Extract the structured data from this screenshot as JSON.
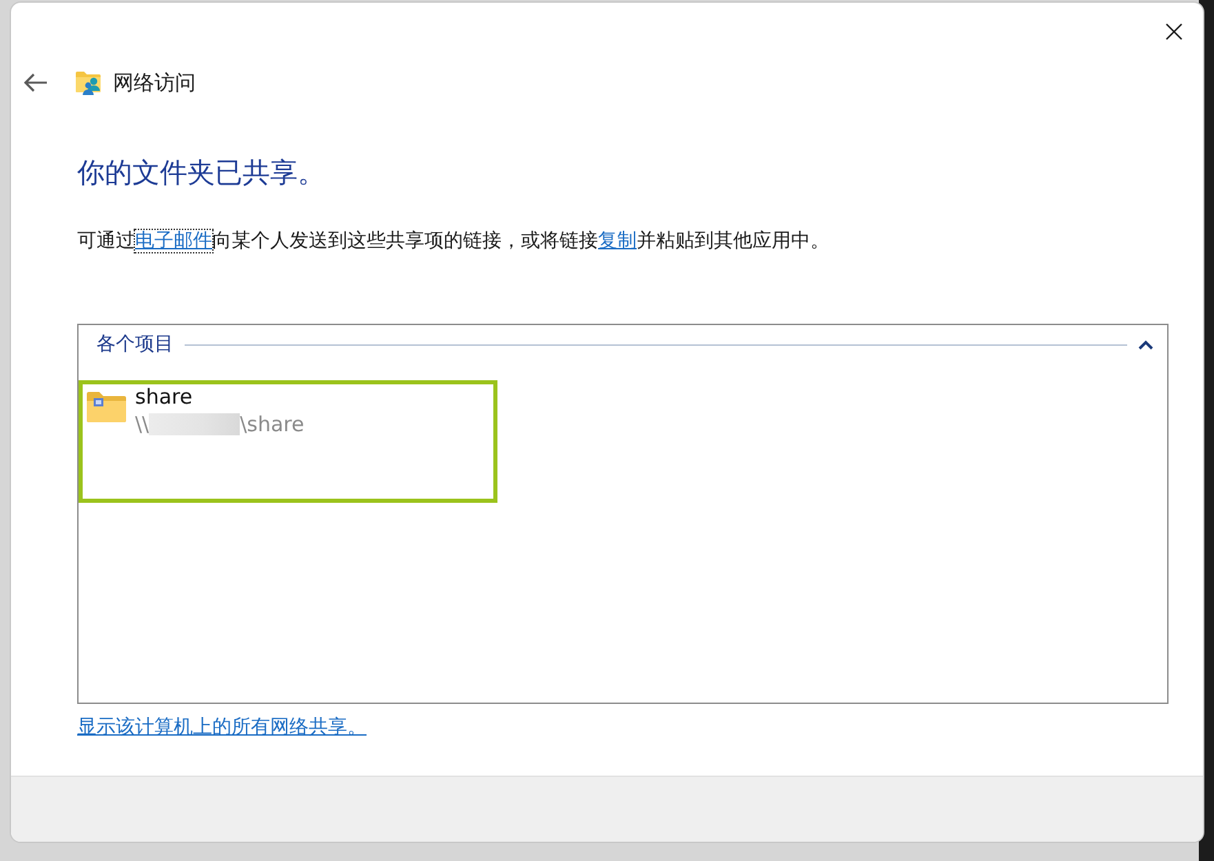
{
  "window": {
    "title": "网络访问"
  },
  "heading": "你的文件夹已共享。",
  "description": [
    {
      "kind": "text",
      "text": "可通过"
    },
    {
      "kind": "link",
      "text": "电子邮件",
      "focused": true
    },
    {
      "kind": "text",
      "text": "向某个人发送到这些共享项的链接，或将链接"
    },
    {
      "kind": "link",
      "text": "复制",
      "focused": false
    },
    {
      "kind": "text",
      "text": "并粘贴到其他应用中。"
    }
  ],
  "shared_items": {
    "title": "各个项目",
    "expanded": true,
    "items": [
      {
        "name": "share",
        "path_start": "\\\\",
        "path_end": "\\share",
        "path_redacted": true,
        "highlighted": true
      }
    ]
  },
  "show_all_link": "显示该计算机上的所有网络共享。"
}
